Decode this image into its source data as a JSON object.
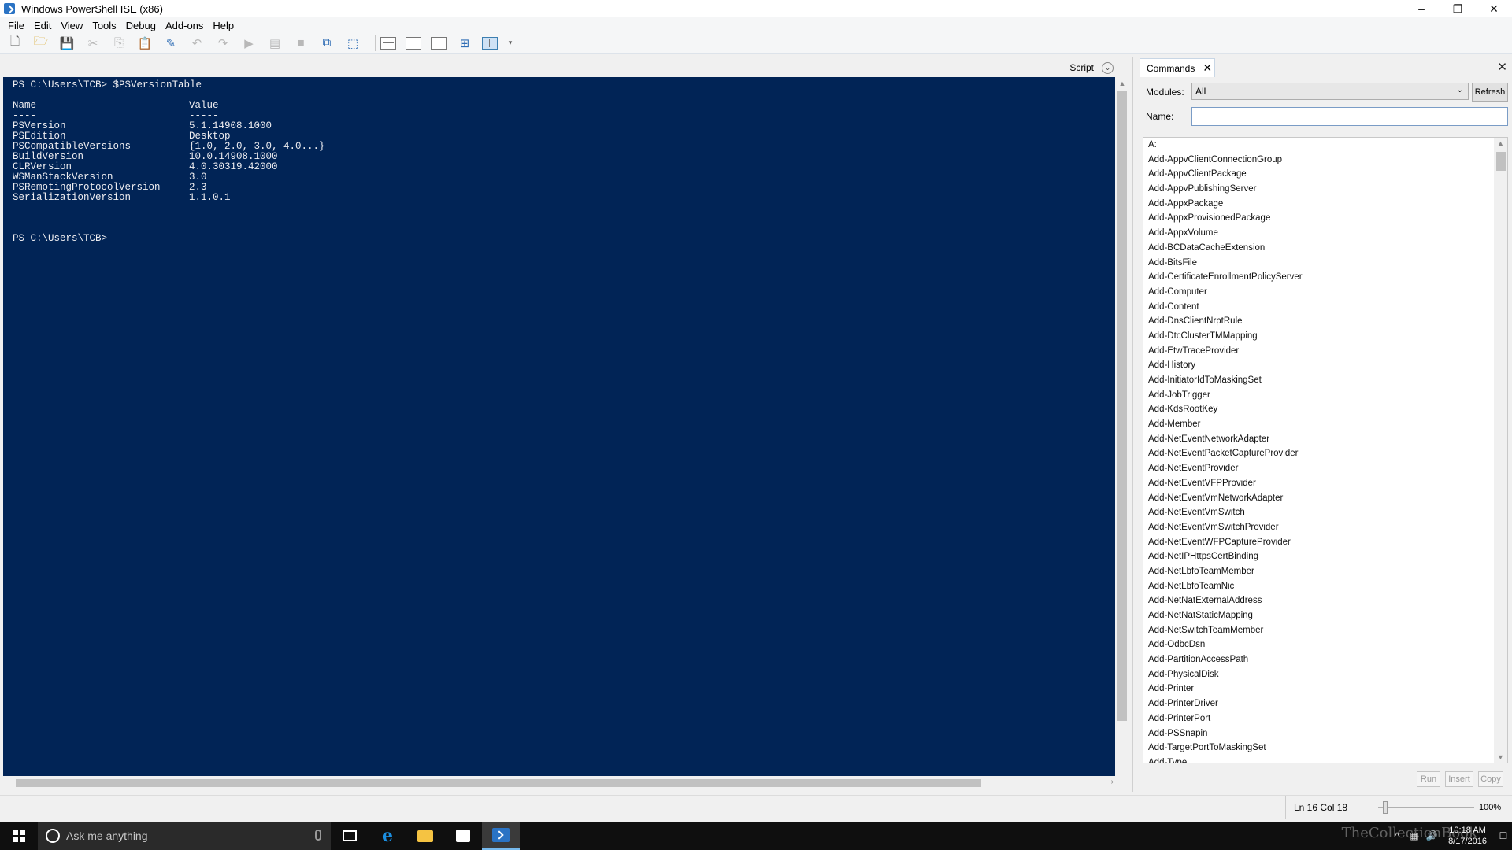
{
  "window": {
    "title": "Windows PowerShell ISE (x86)",
    "controls": [
      "–",
      "❐",
      "✕"
    ]
  },
  "menu": [
    "File",
    "Edit",
    "View",
    "Tools",
    "Debug",
    "Add-ons",
    "Help"
  ],
  "script_strip": {
    "label": "Script",
    "toggle_icon": "⌄"
  },
  "console": {
    "prompt_1": "PS C:\\Users\\TCB> $PSVersionTable",
    "header": {
      "name": "Name",
      "value": "Value"
    },
    "underline": {
      "name": "----",
      "value": "-----"
    },
    "rows": [
      {
        "name": "PSVersion",
        "value": "5.1.14908.1000"
      },
      {
        "name": "PSEdition",
        "value": "Desktop"
      },
      {
        "name": "PSCompatibleVersions",
        "value": "{1.0, 2.0, 3.0, 4.0...}"
      },
      {
        "name": "BuildVersion",
        "value": "10.0.14908.1000"
      },
      {
        "name": "CLRVersion",
        "value": "4.0.30319.42000"
      },
      {
        "name": "WSManStackVersion",
        "value": "3.0"
      },
      {
        "name": "PSRemotingProtocolVersion",
        "value": "2.3"
      },
      {
        "name": "SerializationVersion",
        "value": "1.1.0.1"
      }
    ],
    "prompt_2": "PS C:\\Users\\TCB>"
  },
  "commands": {
    "tab_label": "Commands",
    "modules_label": "Modules:",
    "modules_value": "All",
    "refresh_label": "Refresh",
    "name_label": "Name:",
    "name_value": "",
    "items": [
      "A:",
      "Add-AppvClientConnectionGroup",
      "Add-AppvClientPackage",
      "Add-AppvPublishingServer",
      "Add-AppxPackage",
      "Add-AppxProvisionedPackage",
      "Add-AppxVolume",
      "Add-BCDataCacheExtension",
      "Add-BitsFile",
      "Add-CertificateEnrollmentPolicyServer",
      "Add-Computer",
      "Add-Content",
      "Add-DnsClientNrptRule",
      "Add-DtcClusterTMMapping",
      "Add-EtwTraceProvider",
      "Add-History",
      "Add-InitiatorIdToMaskingSet",
      "Add-JobTrigger",
      "Add-KdsRootKey",
      "Add-Member",
      "Add-NetEventNetworkAdapter",
      "Add-NetEventPacketCaptureProvider",
      "Add-NetEventProvider",
      "Add-NetEventVFPProvider",
      "Add-NetEventVmNetworkAdapter",
      "Add-NetEventVmSwitch",
      "Add-NetEventVmSwitchProvider",
      "Add-NetEventWFPCaptureProvider",
      "Add-NetIPHttpsCertBinding",
      "Add-NetLbfoTeamMember",
      "Add-NetLbfoTeamNic",
      "Add-NetNatExternalAddress",
      "Add-NetNatStaticMapping",
      "Add-NetSwitchTeamMember",
      "Add-OdbcDsn",
      "Add-PartitionAccessPath",
      "Add-PhysicalDisk",
      "Add-Printer",
      "Add-PrinterDriver",
      "Add-PrinterPort",
      "Add-PSSnapin",
      "Add-TargetPortToMaskingSet",
      "Add-Type"
    ],
    "run_label": "Run",
    "insert_label": "Insert",
    "copy_label": "Copy"
  },
  "status": {
    "position": "Ln 16  Col 18",
    "zoom": "100%",
    "zoom_level": 0.05
  },
  "taskbar": {
    "search_placeholder": "Ask me anything",
    "time": "10:18 AM",
    "date": "8/17/2016",
    "watermark": "TheCollectionBook"
  },
  "colors": {
    "console_bg": "#012456",
    "console_fg": "#eeedf0",
    "taskbar_bg": "#0f0f0f"
  }
}
